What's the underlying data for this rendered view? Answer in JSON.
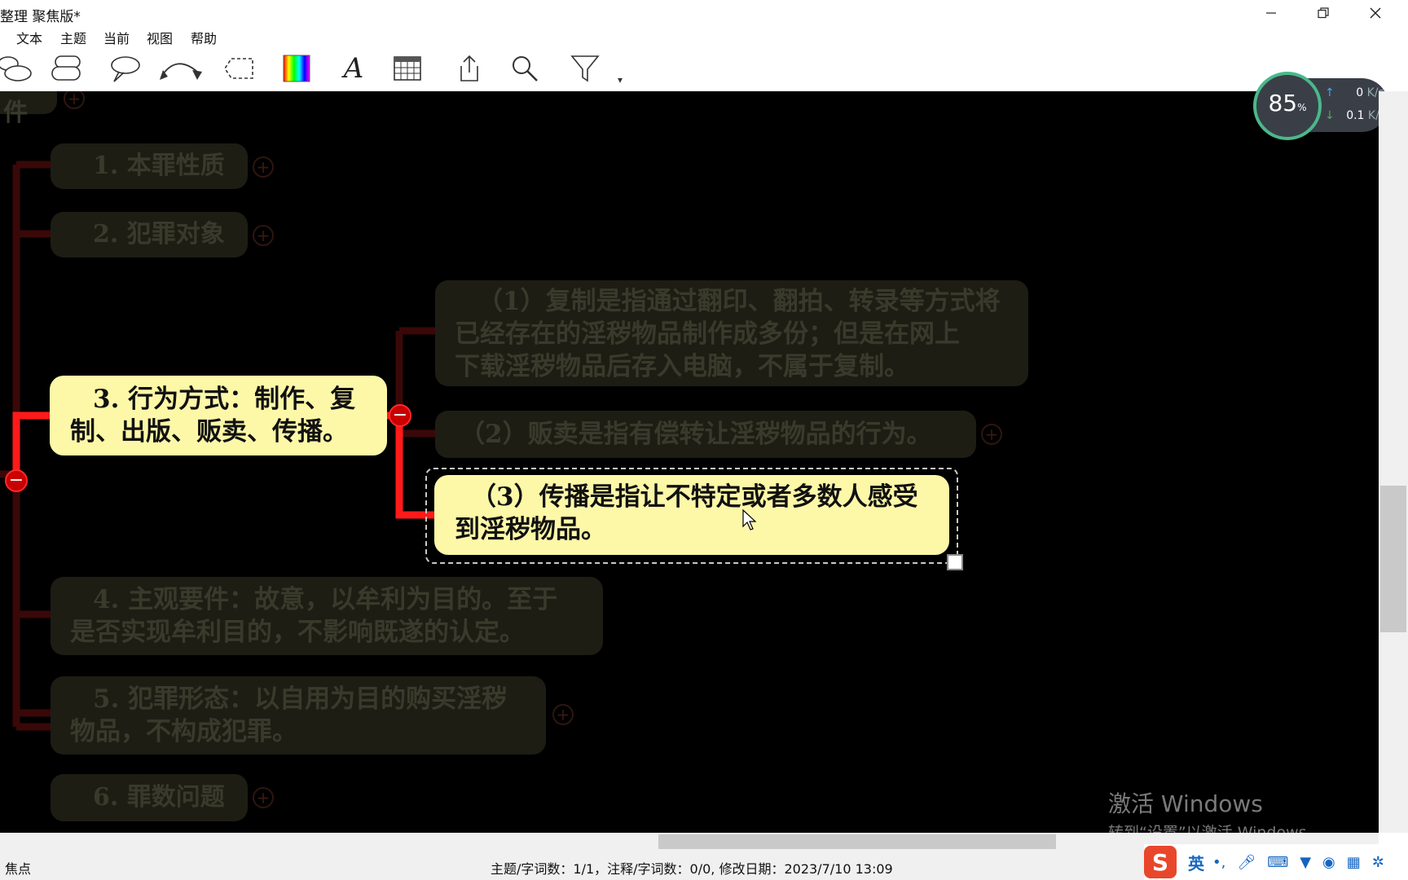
{
  "window": {
    "title": "整理 聚焦版*",
    "minimize": "—",
    "restore": "❐",
    "close": "✕"
  },
  "menu": [
    "文本",
    "主题",
    "当前",
    "视图",
    "帮助"
  ],
  "toolbar": {
    "icons": [
      "topic-shape-icon",
      "multi-topic-icon",
      "callout-icon",
      "relationship-icon",
      "boundary-icon",
      "color-gradient-icon",
      "font-icon",
      "table-icon",
      "share-icon",
      "search-icon",
      "filter-icon",
      "more-icon"
    ],
    "font_glyph": "A",
    "more_glyph": "▾"
  },
  "mindmap": {
    "partial_label": "要件",
    "nodes": [
      {
        "text": "1. 本罪性质",
        "state": "dim"
      },
      {
        "text": "2. 犯罪对象",
        "state": "dim"
      },
      {
        "line1": "3. 行为方式：制作、复",
        "line2": "制、出版、贩卖、传播。",
        "state": "lit"
      },
      {
        "line1": "（1）复制是指通过翻印、翻拍、转录等方式将",
        "line2": "已经存在的淫秽物品制作成多份；但是在网上",
        "line3": "下载淫秽物品后存入电脑，不属于复制。",
        "state": "dim"
      },
      {
        "text": "（2）贩卖是指有偿转让淫秽物品的行为。",
        "state": "dim"
      },
      {
        "line1": "（3）传播是指让不特定或者多数人感受",
        "line2": "到淫秽物品。",
        "state": "selected"
      },
      {
        "line1": "4. 主观要件：故意，以牟利为目的。至于",
        "line2": "是否实现牟利目的，不影响既遂的认定。",
        "state": "dim"
      },
      {
        "line1": "5. 犯罪形态：以自用为目的购买淫秽",
        "line2": "物品，不构成犯罪。",
        "state": "dim"
      },
      {
        "text": "6. 罪数问题",
        "state": "dim"
      }
    ],
    "expand_glyph": "+",
    "collapse_glyph": "−",
    "colors": {
      "branch_active": "#ff1a1a",
      "branch_dim": "#3a0808",
      "node_lit": "#fdf8a8",
      "node_dim": "#1d1d14"
    }
  },
  "network": {
    "percent": "85",
    "percent_unit": "%",
    "up": "0",
    "down": "0.1",
    "unit": "K/s"
  },
  "watermark": {
    "line1": "激活 Windows",
    "line2": "转到“设置”以激活 Windows。"
  },
  "status": {
    "left": "焦点",
    "center": "主题/字词数：1/1，注释/字词数：0/0, 修改日期：2023/7/10 13:09"
  },
  "ime": {
    "logo": "S",
    "lang": "英",
    "icons": [
      "punctuation-icon",
      "microphone-icon",
      "keyboard-icon",
      "skin-icon",
      "game-icon",
      "toolbox-icon",
      "settings-icon"
    ]
  }
}
